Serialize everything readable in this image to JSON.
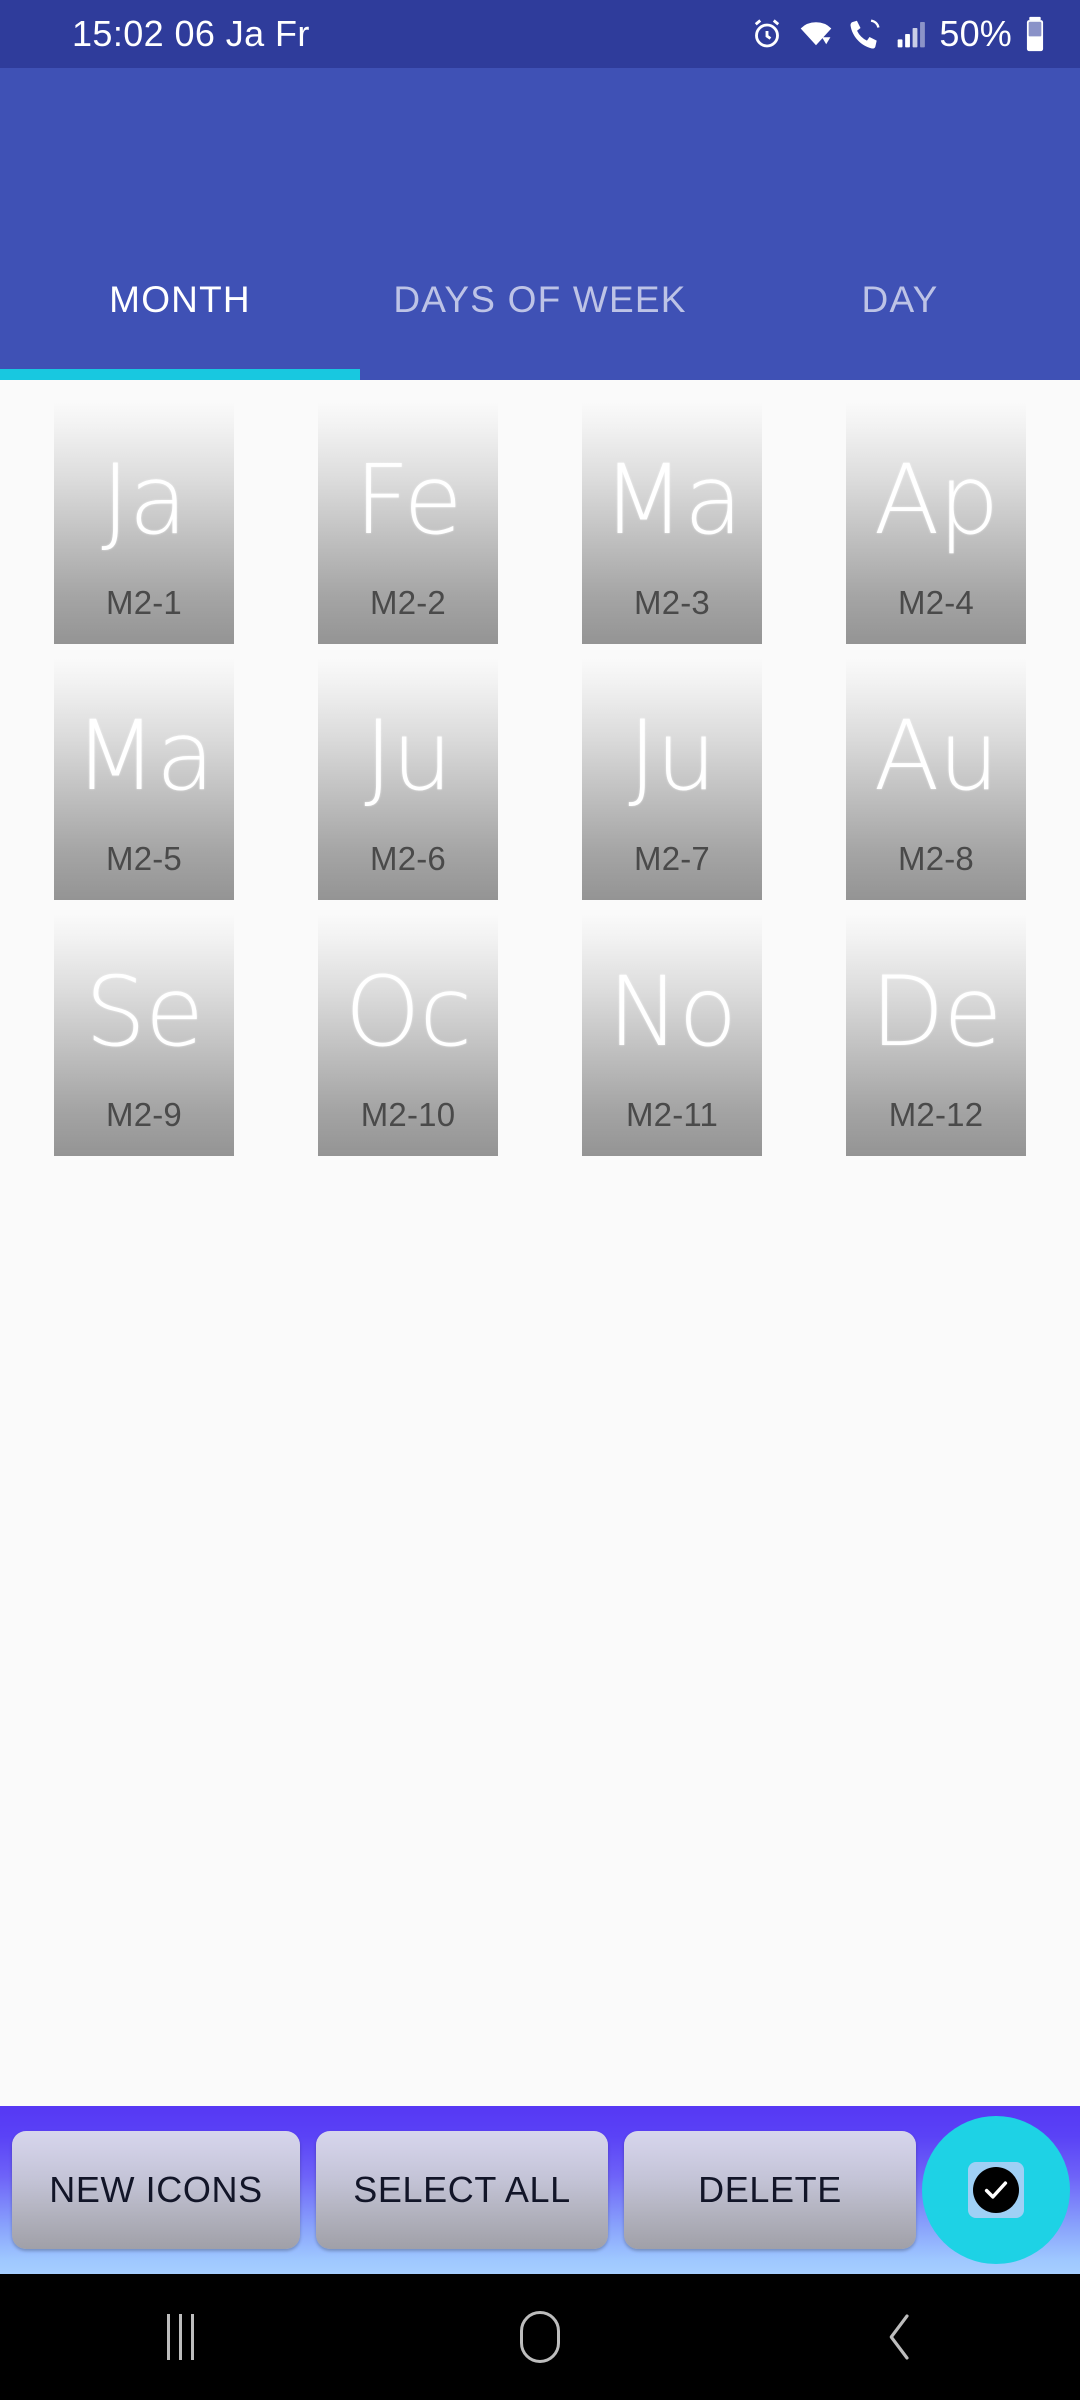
{
  "status_bar": {
    "time_date": "15:02 06 Ja Fr",
    "battery_percent": "50%",
    "icons": [
      "alarm-icon",
      "wifi-icon",
      "call-wifi-icon",
      "signal-icon",
      "battery-icon"
    ],
    "background_color": "#2F3C9B"
  },
  "app_bar": {
    "background_color": "#3F51B5",
    "indicator_color": "#18C8E0",
    "tabs": [
      {
        "label": "MONTH",
        "active": true
      },
      {
        "label": "DAYS OF WEEK",
        "active": false
      },
      {
        "label": "DAY",
        "active": false
      }
    ]
  },
  "grid": {
    "tiles": [
      {
        "glyph": "Ja",
        "label": "M2-1"
      },
      {
        "glyph": "Fe",
        "label": "M2-2"
      },
      {
        "glyph": "Ma",
        "label": "M2-3"
      },
      {
        "glyph": "Ap",
        "label": "M2-4"
      },
      {
        "glyph": "Ma",
        "label": "M2-5"
      },
      {
        "glyph": "Ju",
        "label": "M2-6"
      },
      {
        "glyph": "Ju",
        "label": "M2-7"
      },
      {
        "glyph": "Au",
        "label": "M2-8"
      },
      {
        "glyph": "Se",
        "label": "M2-9"
      },
      {
        "glyph": "Oc",
        "label": "M2-10"
      },
      {
        "glyph": "No",
        "label": "M2-11"
      },
      {
        "glyph": "De",
        "label": "M2-12"
      }
    ]
  },
  "bottom_bar": {
    "new_icons_label": "NEW ICONS",
    "select_all_label": "SELECT ALL",
    "delete_label": "DELETE",
    "fab_icon": "check-icon",
    "fab_color": "#1ED2E5"
  },
  "nav_bar": {
    "recents_icon": "recents-icon",
    "home_icon": "home-icon",
    "back_icon": "back-icon"
  }
}
